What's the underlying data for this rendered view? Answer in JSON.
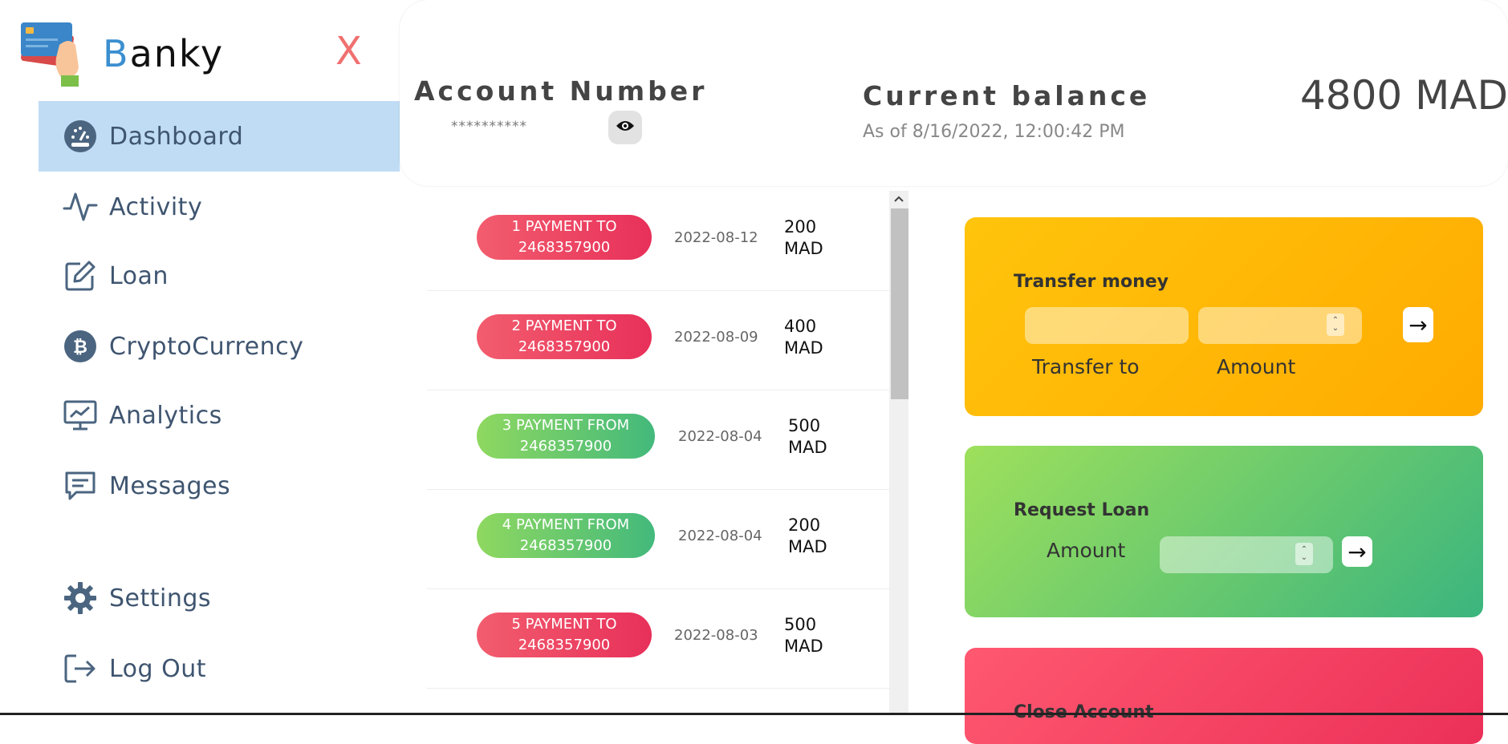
{
  "app": {
    "brand_first": "B",
    "brand_rest": "anky"
  },
  "sidebar": {
    "items": [
      {
        "label": "Dashboard",
        "icon": "dashboard-gauge-icon"
      },
      {
        "label": "Activity",
        "icon": "activity-pulse-icon"
      },
      {
        "label": "Loan",
        "icon": "edit-note-icon"
      },
      {
        "label": "CryptoCurrency",
        "icon": "bitcoin-icon"
      },
      {
        "label": "Analytics",
        "icon": "monitor-chart-icon"
      },
      {
        "label": "Messages",
        "icon": "message-icon"
      },
      {
        "label": "Settings",
        "icon": "gear-icon"
      },
      {
        "label": "Log Out",
        "icon": "logout-icon"
      }
    ],
    "close_label": "X"
  },
  "account": {
    "title": "Account Number",
    "masked": "**********"
  },
  "balance": {
    "title": "Current balance",
    "date": "As of 8/16/2022, 12:00:42 PM",
    "amount": "4800 MAD"
  },
  "movements": [
    {
      "line1": "1 PAYMENT TO",
      "line2": "2468357900",
      "date": "2022-08-12",
      "amount": "200",
      "currency": "MAD",
      "type": "withdrawal"
    },
    {
      "line1": "2 PAYMENT TO",
      "line2": "2468357900",
      "date": "2022-08-09",
      "amount": "400",
      "currency": "MAD",
      "type": "withdrawal"
    },
    {
      "line1": "3 PAYMENT FROM",
      "line2": "2468357900",
      "date": "2022-08-04",
      "amount": "500",
      "currency": "MAD",
      "type": "deposit"
    },
    {
      "line1": "4 PAYMENT FROM",
      "line2": "2468357900",
      "date": "2022-08-04",
      "amount": "200",
      "currency": "MAD",
      "type": "deposit"
    },
    {
      "line1": "5 PAYMENT TO",
      "line2": "2468357900",
      "date": "2022-08-03",
      "amount": "500",
      "currency": "MAD",
      "type": "withdrawal"
    }
  ],
  "operations": {
    "transfer": {
      "title": "Transfer money",
      "to_label": "Transfer to",
      "amount_label": "Amount",
      "to_value": "",
      "amount_value": "",
      "button": "→"
    },
    "loan": {
      "title": "Request Loan",
      "amount_label": "Amount",
      "amount_value": "",
      "button": "→"
    },
    "close": {
      "title": "Close Account"
    }
  },
  "colors": {
    "accent": "#3b8fd0",
    "active_nav": "#c0dcf4",
    "transfer": "#ffb800",
    "loan": "#6fcf6f",
    "close": "#f24060"
  }
}
